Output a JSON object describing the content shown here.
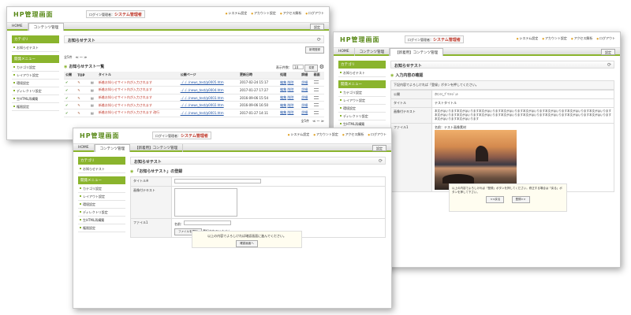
{
  "app": {
    "logo": "HP管理画面",
    "role_prefix": "ログイン管理者：",
    "role_name": "システム管理者",
    "links": [
      "システム設定",
      "アカウント設定",
      "アクセス解析",
      "ログアウト"
    ],
    "settings_button": "設定"
  },
  "tabs": {
    "home": "HOME",
    "content": "コンテンツ管理",
    "new": "【新着用】コンテンツ管理"
  },
  "sidebar": {
    "cat_header": "カテゴリ",
    "cat_item": "お知らせテスト",
    "menu_header": "開発メニュー",
    "menu_items": [
      "カテゴリ設定",
      "レイアウト設定",
      "環境設定",
      "ディレクトリ設定",
      "生HTML再構築",
      "権限設定"
    ]
  },
  "back": {
    "title": "お知らせテスト",
    "new_button": "新規登録",
    "count": "全5件",
    "pager": "≪ ～ ≫",
    "section": "お知らせテスト一覧",
    "per_page_label": "表示件数：",
    "per_page": "10",
    "per_page_button": "変更",
    "headers": [
      "公開",
      "TOP",
      "",
      "タイトル",
      "公開ページ",
      "更新日時",
      "処理",
      "詳細",
      "画面"
    ],
    "rows": [
      {
        "title": "新着お知らせサイト内が入力されます",
        "page": "../../../news_test/p0005.htm",
        "date": "2017-02-24 15:17",
        "extra": ""
      },
      {
        "title": "新着お知らせサイト内が入力されます",
        "page": "../../../news_test/p0004.htm",
        "date": "2017-01-27 17:27",
        "extra": ""
      },
      {
        "title": "新着お知らせサイト内が入力されます",
        "page": "../../../news_test/p0003.htm",
        "date": "2016-09-06 15:54",
        "extra": ""
      },
      {
        "title": "新着お知らせサイト内が入力されます",
        "page": "../../../news_test/p0002.htm",
        "date": "2016-09-06 16:50",
        "extra": ""
      },
      {
        "title": "新着お知らせサイト内が入力されます",
        "page": "../../../news_test/p0001.htm",
        "date": "2017-01-27 14:11",
        "extra": "改行"
      }
    ],
    "edit_label": "編集",
    "delete_label": "削除",
    "detail_label": "詳細"
  },
  "right": {
    "title": "お知らせテスト",
    "section": "入力内容の確認",
    "notice": "下記内容でよろしければ「登録」ボタンを押してください。",
    "fields": [
      {
        "label": "公開",
        "value": "ｵｷﾆｲｲ_ﾌﾟﾘﾝﾄｼﾞｯﾄ"
      },
      {
        "label": "タイトル",
        "value": "テストタイトル"
      },
      {
        "label": "画像付テキスト",
        "value": "本文がはいります本文がはいります本文がはいります本文がはいります本文がはいります本文がはいります本文がはいります本文がはいります本文がはいります本文がはいります本文がはいります本文がはいります本文がはいります本文がはいります本文がはいります本文がはいります本文がはいります本文がはいります"
      },
      {
        "label": "ファイル1",
        "value": "名前：テスト画像素材"
      }
    ],
    "confirm_text": "以上の内容でよろしければ「登録」ボタンを押してください。修正する場合は「戻る」ボタンを押して下さい。",
    "back_button": "<<戻る",
    "register_button": "登録>>"
  },
  "front": {
    "title": "お知らせテスト",
    "section": "「お知らせテスト」の登録",
    "title_label": "タイトル※",
    "text_label": "画像付テキスト",
    "file_label": "ファイル1",
    "name_label": "名前：",
    "file_button": "ファイルを選択",
    "file_status": "選択されていません",
    "confirm_text": "以上の内容でよろしければ確認画面に進んでください。",
    "confirm_button": "確認画面へ"
  }
}
